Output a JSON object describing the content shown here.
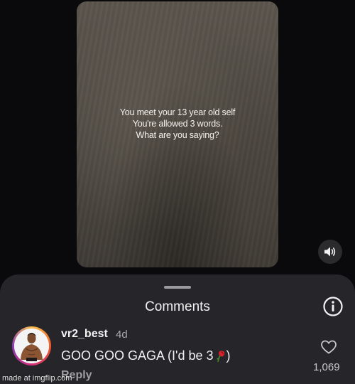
{
  "video": {
    "caption_lines": [
      "You meet your 13 year old self",
      "You're allowed 3 words.",
      "What are you saying?"
    ],
    "volume_icon": "speaker-icon"
  },
  "comments_sheet": {
    "title": "Comments",
    "info_icon": "info-icon"
  },
  "comment": {
    "username": "vr2_best",
    "timestamp": "4d",
    "text_before": "GOO GOO GAGA (I'd be 3",
    "text_emoji": "rose-emoji",
    "text_after": ")",
    "reply_label": "Reply",
    "like_icon": "heart-icon",
    "like_count": "1,069"
  },
  "watermark": "made at imgflip.com"
}
